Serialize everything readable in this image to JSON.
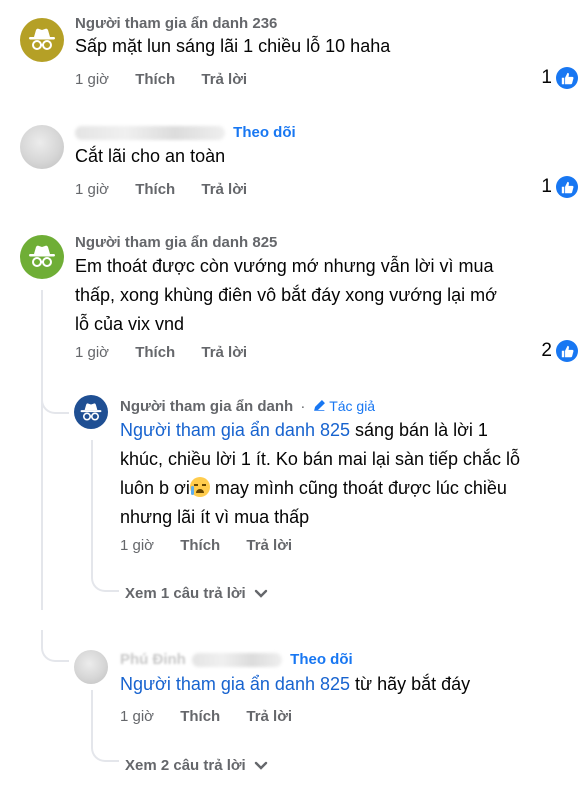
{
  "comments": [
    {
      "name": "Người tham gia ẩn danh 236",
      "text": "Sấp mặt lun sáng lãi 1 chiều lỗ 10 haha",
      "time": "1 giờ",
      "like": "Thích",
      "reply": "Trả lời",
      "reactions": "1",
      "avatar": "anonymous-icon"
    },
    {
      "name": "",
      "follow": "Theo dõi",
      "text": "Cắt lãi cho an toàn",
      "time": "1 giờ",
      "like": "Thích",
      "reply": "Trả lời",
      "reactions": "1",
      "avatar": "blurred-photo"
    },
    {
      "name": "Người tham gia ẩn danh 825",
      "text_lines": [
        "Em thoát được còn vướng mớ nhưng vẫn lời vì mua",
        "thấp, xong khùng điên vô bắt đáy xong vướng lại mớ",
        "lỗ của vix vnd"
      ],
      "time": "1 giờ",
      "like": "Thích",
      "reply": "Trả lời",
      "reactions": "2",
      "avatar": "anonymous-icon"
    }
  ],
  "replies": [
    {
      "name": "Người tham gia ẩn danh",
      "separator": "·",
      "badge": "Tác giả",
      "mention": "Người tham gia ẩn danh 825",
      "line1_rest": " sáng bán là lời 1",
      "line2": "khúc, chiều lời 1 ít. Ko bán mai lại sàn tiếp chắc lỗ",
      "line3_before": "luôn b ơi",
      "line3_after": " may mình cũng thoát được lúc chiều",
      "line4": "nhưng lãi ít vì mua thấp",
      "time": "1 giờ",
      "like": "Thích",
      "reply": "Trả lời",
      "view_more": "Xem 1 câu trả lời",
      "avatar": "anonymous-icon"
    },
    {
      "name": "Phú Đinh",
      "follow": "Theo dõi",
      "mention": "Người tham gia ẩn danh 825",
      "text_rest": " từ hãy bắt đáy",
      "time": "1 giờ",
      "like": "Thích",
      "reply": "Trả lời",
      "view_more": "Xem 2 câu trả lời",
      "avatar": "blurred-photo"
    }
  ],
  "colors": {
    "link": "#1877f2",
    "muted": "#65676b",
    "like_badge": "#1877f2"
  }
}
